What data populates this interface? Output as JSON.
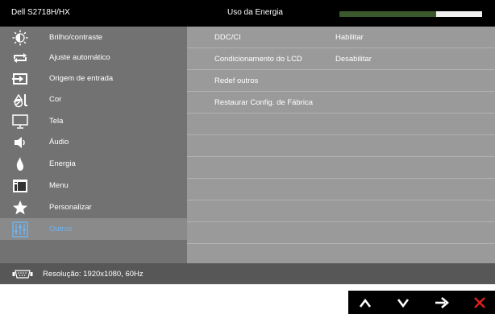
{
  "header": {
    "brand": "Dell S2718H/HX",
    "energy_label": "Uso da Energia",
    "energy_level_percent": 68,
    "energy_color": "#3a5a2e"
  },
  "sidebar": {
    "items": [
      {
        "label": "Brilho/contraste",
        "icon": "brightness-icon"
      },
      {
        "label": "Ajuste automático",
        "icon": "auto-adjust-icon"
      },
      {
        "label": "Origem de entrada",
        "icon": "input-source-icon"
      },
      {
        "label": "Cor",
        "icon": "color-icon"
      },
      {
        "label": "Tela",
        "icon": "display-icon"
      },
      {
        "label": "Áudio",
        "icon": "audio-icon"
      },
      {
        "label": "Energia",
        "icon": "energy-icon"
      },
      {
        "label": "Menu",
        "icon": "menu-icon"
      },
      {
        "label": "Personalizar",
        "icon": "star-icon"
      },
      {
        "label": "Outros",
        "icon": "sliders-icon"
      }
    ],
    "active_index": 9,
    "active_color": "#6fb3ea"
  },
  "content": {
    "rows": [
      {
        "label": "DDC/CI",
        "value": "Habilitar"
      },
      {
        "label": "Condicionamento do LCD",
        "value": "Desabilitar"
      },
      {
        "label": "Redef outros",
        "value": ""
      },
      {
        "label": "Restaurar Config. de Fábrica",
        "value": ""
      }
    ]
  },
  "footer": {
    "resolution": "Resolução: 1920x1080, 60Hz",
    "icon": "vga-connector-icon"
  },
  "nav": {
    "buttons": [
      "up-arrow-icon",
      "down-arrow-icon",
      "right-arrow-icon",
      "close-icon"
    ],
    "close_color": "#e0201f"
  }
}
